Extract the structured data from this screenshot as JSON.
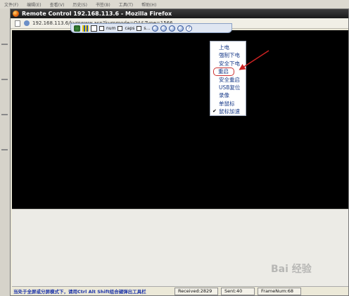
{
  "host": {
    "menubar": [
      "文件(F)",
      "编辑(E)",
      "查看(V)",
      "历史(S)",
      "书签(B)",
      "工具(T)",
      "帮助(H)"
    ]
  },
  "window": {
    "title": "Remote Control 192.168.113.6 - Mozilla Firefox",
    "url": "192.168.113.6/kvmwww.asp?kvmmode=OA&Type=1566"
  },
  "toolbar": {
    "num_label": "num",
    "caps_label": "caps",
    "s_label": "s..."
  },
  "menu": {
    "items": [
      {
        "label": "上电",
        "checked": false
      },
      {
        "label": "强制下电",
        "checked": false
      },
      {
        "label": "安全下电",
        "checked": false
      },
      {
        "label": "重启",
        "checked": false,
        "highlighted": true
      },
      {
        "label": "安全重启",
        "checked": false
      },
      {
        "label": "USB复位",
        "checked": false
      },
      {
        "label": "录像",
        "checked": false
      },
      {
        "label": "单鼠标",
        "checked": false
      },
      {
        "label": "鼠标加速",
        "checked": true
      }
    ]
  },
  "status": {
    "message": "当处于全屏或分屏模式下，请用Ctrl Alt Shift组合键弹出工具栏",
    "received": "Received:2829",
    "sent": "Sent:40",
    "frame": "FrameNum:68"
  },
  "watermark": "Bai 经验",
  "colors": {
    "remote_bg": "#000000",
    "menu_text": "#1a3c8a",
    "highlight_outline": "#cc3333",
    "arrow": "#cc2222",
    "status_msg": "#1a32a8"
  }
}
